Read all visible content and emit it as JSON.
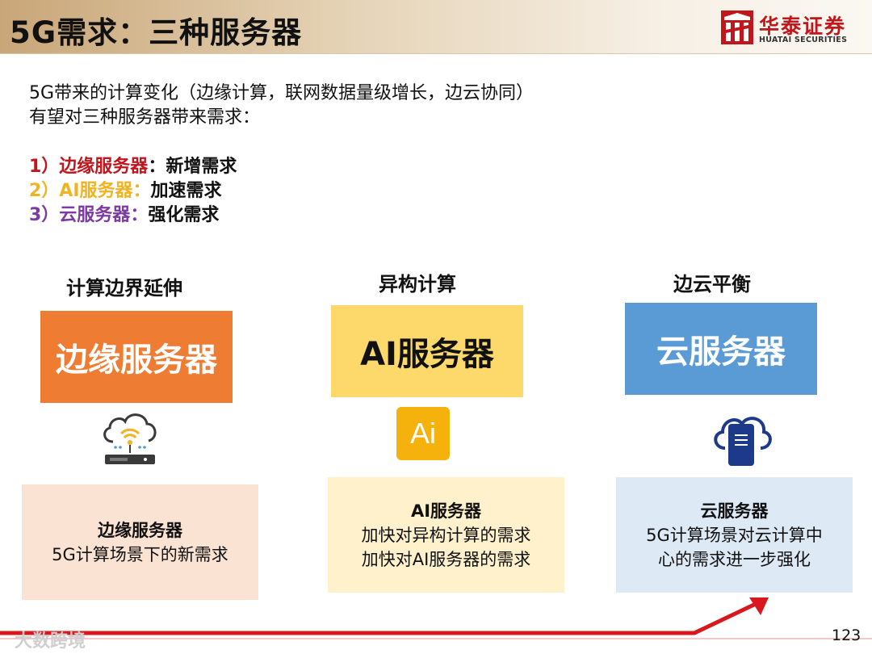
{
  "header": {
    "title": "5G需求：三种服务器",
    "logo_cn": "华泰证券",
    "logo_en": "HUATAI SECURITIES",
    "accent_color": "#c0161c"
  },
  "intro": {
    "line1": "5G带来的计算变化（边缘计算，联网数据量级增长，边云协同）",
    "line2": "有望对三种服务器带来需求："
  },
  "list": [
    {
      "prefix": "1）边缘服务器",
      "sep": "：",
      "desc": "新增需求",
      "color": "#c0161c"
    },
    {
      "prefix": "2）AI服务器",
      "sep": "：",
      "desc": "加速需求",
      "color": "#f0b323"
    },
    {
      "prefix": "3）云服务器",
      "sep": "：",
      "desc": "强化需求",
      "color": "#7c3aa3"
    }
  ],
  "columns": [
    {
      "heading": "计算边界延伸",
      "box_label": "边缘服务器",
      "box_color": "#ee7d33",
      "icon": "cloud-wifi-server-icon",
      "card_title": "边缘服务器",
      "card_lines": [
        "5G计算场景下的新需求"
      ]
    },
    {
      "heading": "异构计算",
      "box_label": "AI服务器",
      "box_color": "#fdd86b",
      "icon": "ai-chip-icon",
      "icon_text": "Ai",
      "card_title": "AI服务器",
      "card_lines": [
        "加快对异构计算的需求",
        "加快对AI服务器的需求"
      ]
    },
    {
      "heading": "边云平衡",
      "box_label": "云服务器",
      "box_color": "#5b9bd5",
      "icon": "cloud-server-icon",
      "card_title": "云服务器",
      "card_lines": [
        "5G计算场景对云计算中",
        "心的需求进一步强化"
      ]
    }
  ],
  "footer": {
    "page_number": "123",
    "watermark": "大数跨境"
  }
}
